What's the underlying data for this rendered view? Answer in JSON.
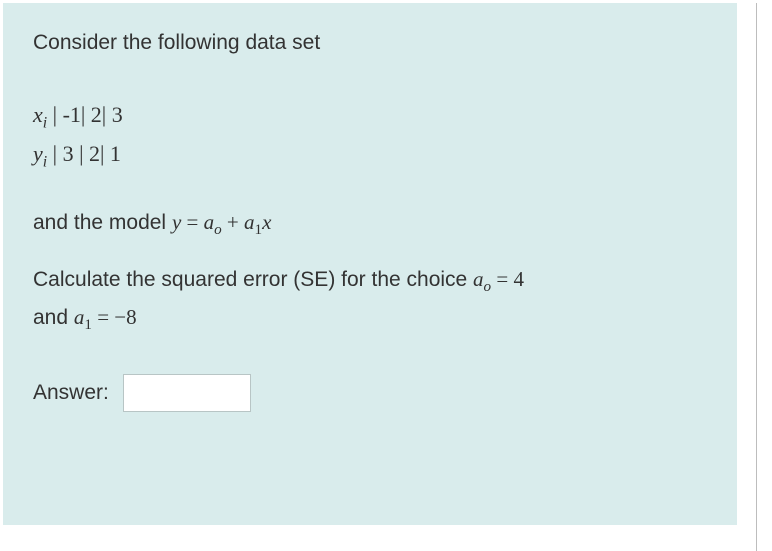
{
  "intro": "Consider the following data set",
  "data_rows": {
    "row1_var": "x",
    "row1_sub": "i",
    "row1_rest": " | -1| 2| 3",
    "row2_var": "y",
    "row2_sub": "i",
    "row2_rest": " | 3 | 2| 1"
  },
  "model": {
    "prefix": "and the model ",
    "y": "y",
    "eq": " = ",
    "a": "a",
    "sub_o": "o",
    "plus": " + ",
    "sub_1": "1",
    "x": "x"
  },
  "calc": {
    "line1_a": "Calculate the squared error (SE) for the choice ",
    "a": "a",
    "sub_o": "o",
    "eq4": " = 4",
    "line2_a": "and ",
    "sub_1": "1",
    "eq_m8": " = −8"
  },
  "answer_label": "Answer:",
  "answer_value": ""
}
